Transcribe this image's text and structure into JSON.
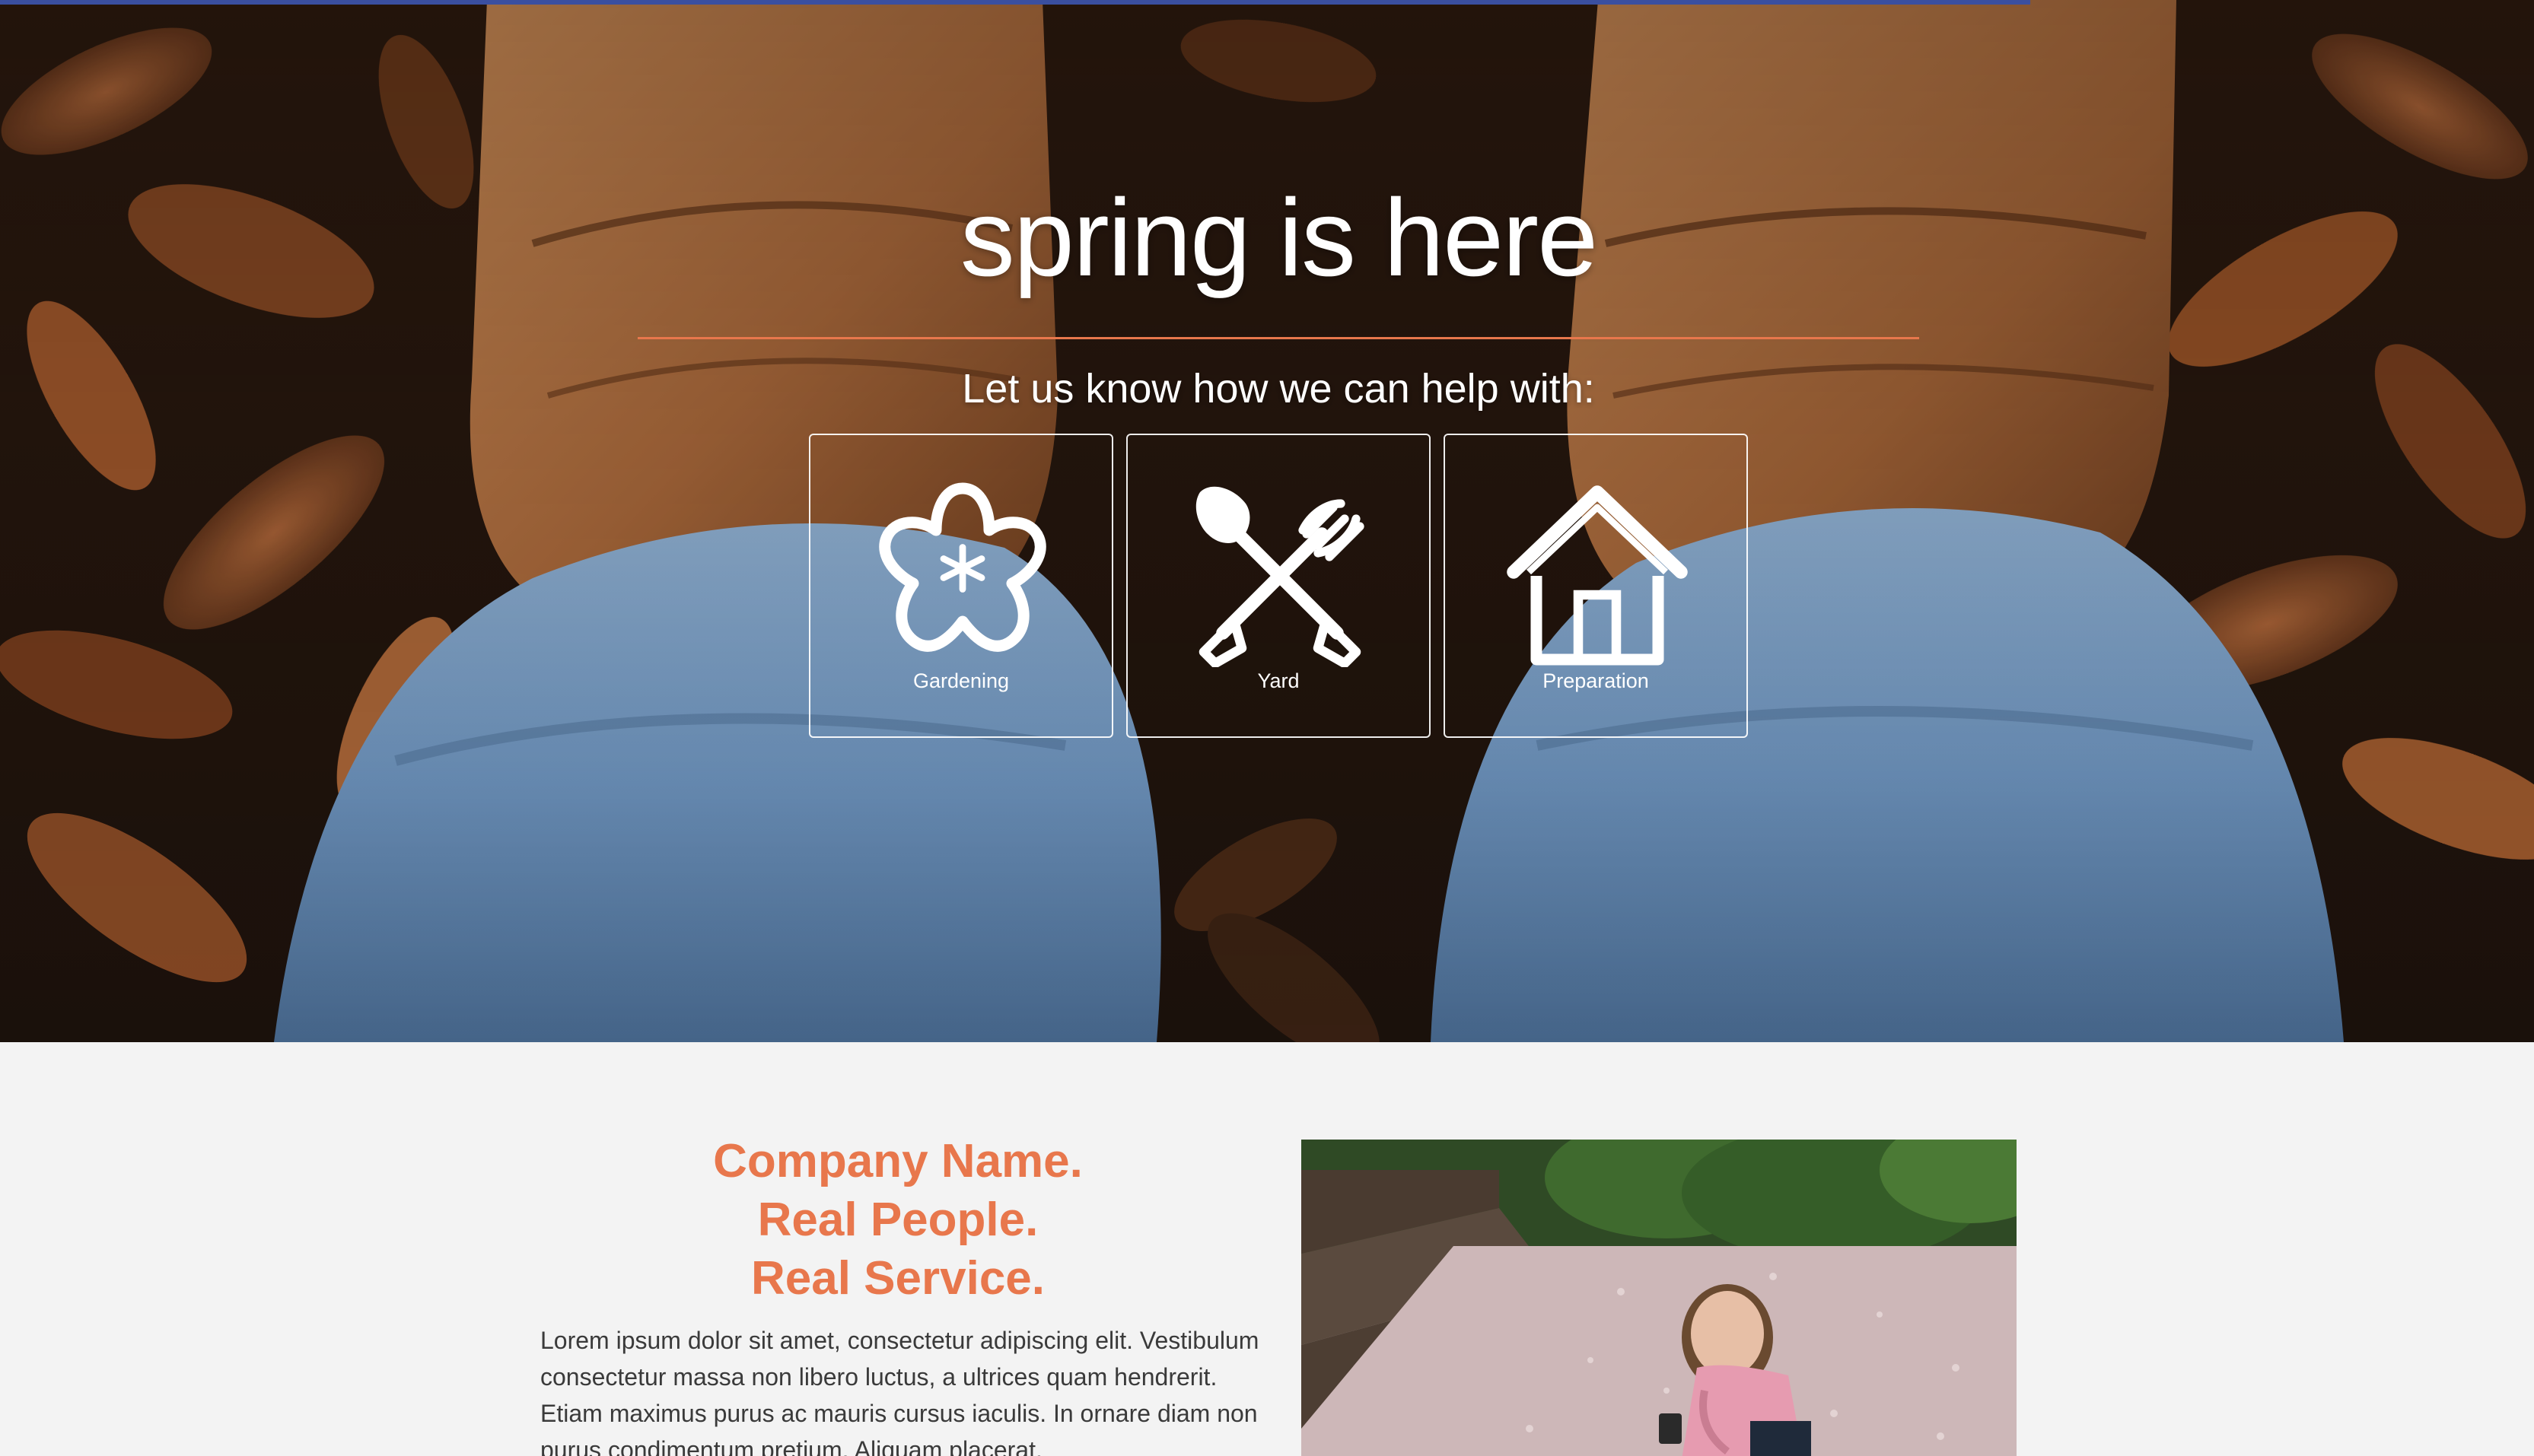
{
  "hero": {
    "title": "spring is here",
    "subtitle": "Let us know how we can help with:",
    "background_image": "boots-on-autumn-leaves",
    "services": [
      {
        "label": "Gardening",
        "icon": "flower-icon"
      },
      {
        "label": "Yard",
        "icon": "shovel-rake-icon"
      },
      {
        "label": "Preparation",
        "icon": "house-icon"
      }
    ]
  },
  "about": {
    "headline": [
      "Company Name.",
      "Real People.",
      "Real Service."
    ],
    "body": "Lorem ipsum dolor sit amet, consectetur adipiscing elit. Vestibulum consectetur massa non libero luctus, a ultrices quam hendrerit. Etiam maximus purus ac mauris cursus iaculis. In ornare diam non purus condimentum pretium. Aliquam placerat.",
    "image": "child-on-petal-covered-path"
  },
  "colors": {
    "accent": "#e8774c",
    "progress": "#3a4fa0",
    "page_bg": "#f3f3f3",
    "text": "#3a3a3a"
  }
}
